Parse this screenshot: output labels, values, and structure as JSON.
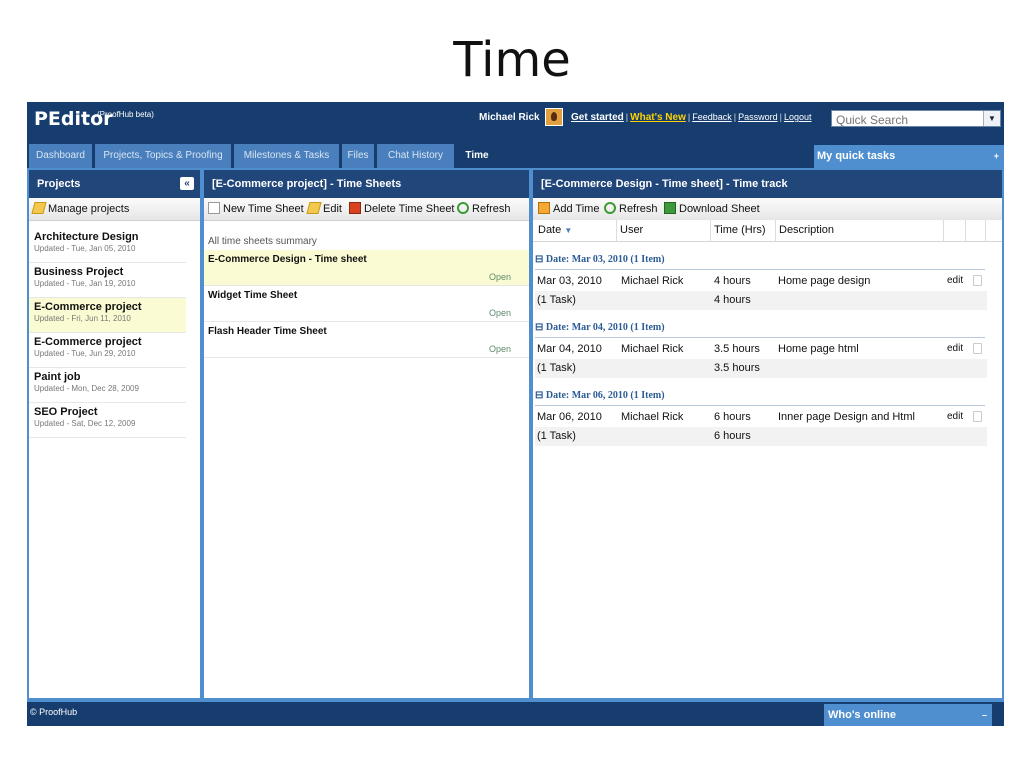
{
  "slide": {
    "title": "Time"
  },
  "header": {
    "logo": "PEditor",
    "logo_sub": "(ProofHub beta)",
    "user": "Michael Rick",
    "links": {
      "get_started": "Get started",
      "whats_new": "What's New",
      "feedback": "Feedback",
      "password": "Password",
      "logout": "Logout"
    },
    "search_placeholder": "Quick Search"
  },
  "tabs": [
    {
      "label": "Dashboard"
    },
    {
      "label": "Projects, Topics & Proofing"
    },
    {
      "label": "Milestones & Tasks"
    },
    {
      "label": "Files"
    },
    {
      "label": "Chat History"
    },
    {
      "label": "Time",
      "active": true
    }
  ],
  "quick_tasks": {
    "label": "My quick tasks",
    "icon": "+"
  },
  "projects_panel": {
    "title": "Projects",
    "collapse_icon": "«",
    "manage_label": "Manage projects",
    "items": [
      {
        "name": "Architecture Design",
        "updated": "Updated - Tue, Jan 05, 2010"
      },
      {
        "name": "Business Project",
        "updated": "Updated - Tue, Jan 19, 2010"
      },
      {
        "name": "E-Commerce project",
        "updated": "Updated - Fri, Jun 11, 2010",
        "selected": true
      },
      {
        "name": "E-Commerce project",
        "updated": "Updated - Tue, Jun 29, 2010"
      },
      {
        "name": "Paint job",
        "updated": "Updated - Mon, Dec 28, 2009"
      },
      {
        "name": "SEO Project",
        "updated": "Updated - Sat, Dec 12, 2009"
      }
    ]
  },
  "timesheets_panel": {
    "title": "[E-Commerce project] - Time Sheets",
    "toolbar": {
      "new": "New Time Sheet",
      "edit": "Edit",
      "delete": "Delete Time Sheet",
      "refresh": "Refresh"
    },
    "summary_label": "All time sheets summary",
    "items": [
      {
        "name": "E-Commerce Design - Time sheet",
        "status": "Open",
        "selected": true
      },
      {
        "name": "Widget Time Sheet",
        "status": "Open"
      },
      {
        "name": "Flash Header Time Sheet",
        "status": "Open"
      }
    ]
  },
  "timetrack_panel": {
    "title": "[E-Commerce Design - Time sheet] - Time track",
    "toolbar": {
      "add": "Add Time",
      "refresh": "Refresh",
      "download": "Download Sheet"
    },
    "columns": {
      "date": "Date",
      "user": "User",
      "time": "Time (Hrs)",
      "description": "Description"
    },
    "groups": [
      {
        "header": "Date: Mar 03, 2010 (1 Item)",
        "row": {
          "date": "Mar 03, 2010",
          "user": "Michael Rick",
          "time": "4 hours",
          "description": "Home page design",
          "edit": "edit"
        },
        "total": {
          "tasks": "(1 Task)",
          "time": "4 hours"
        }
      },
      {
        "header": "Date: Mar 04, 2010 (1 Item)",
        "row": {
          "date": "Mar 04, 2010",
          "user": "Michael Rick",
          "time": "3.5 hours",
          "description": "Home page html",
          "edit": "edit"
        },
        "total": {
          "tasks": "(1 Task)",
          "time": "3.5 hours"
        }
      },
      {
        "header": "Date: Mar 06, 2010 (1 Item)",
        "row": {
          "date": "Mar 06, 2010",
          "user": "Michael Rick",
          "time": "6 hours",
          "description": "Inner page Design and Html",
          "edit": "edit"
        },
        "total": {
          "tasks": "(1 Task)",
          "time": "6 hours"
        }
      }
    ]
  },
  "footer": {
    "copyright": "© ProofHub",
    "whos_online": "Who's online",
    "whos_online_icon": "–"
  },
  "colors": {
    "header_bg": "#163d6e",
    "frame_blue": "#4f8fcf",
    "panel_header": "#20467a",
    "selected_row": "#fafbd3",
    "link_yellow": "#ffd200"
  }
}
